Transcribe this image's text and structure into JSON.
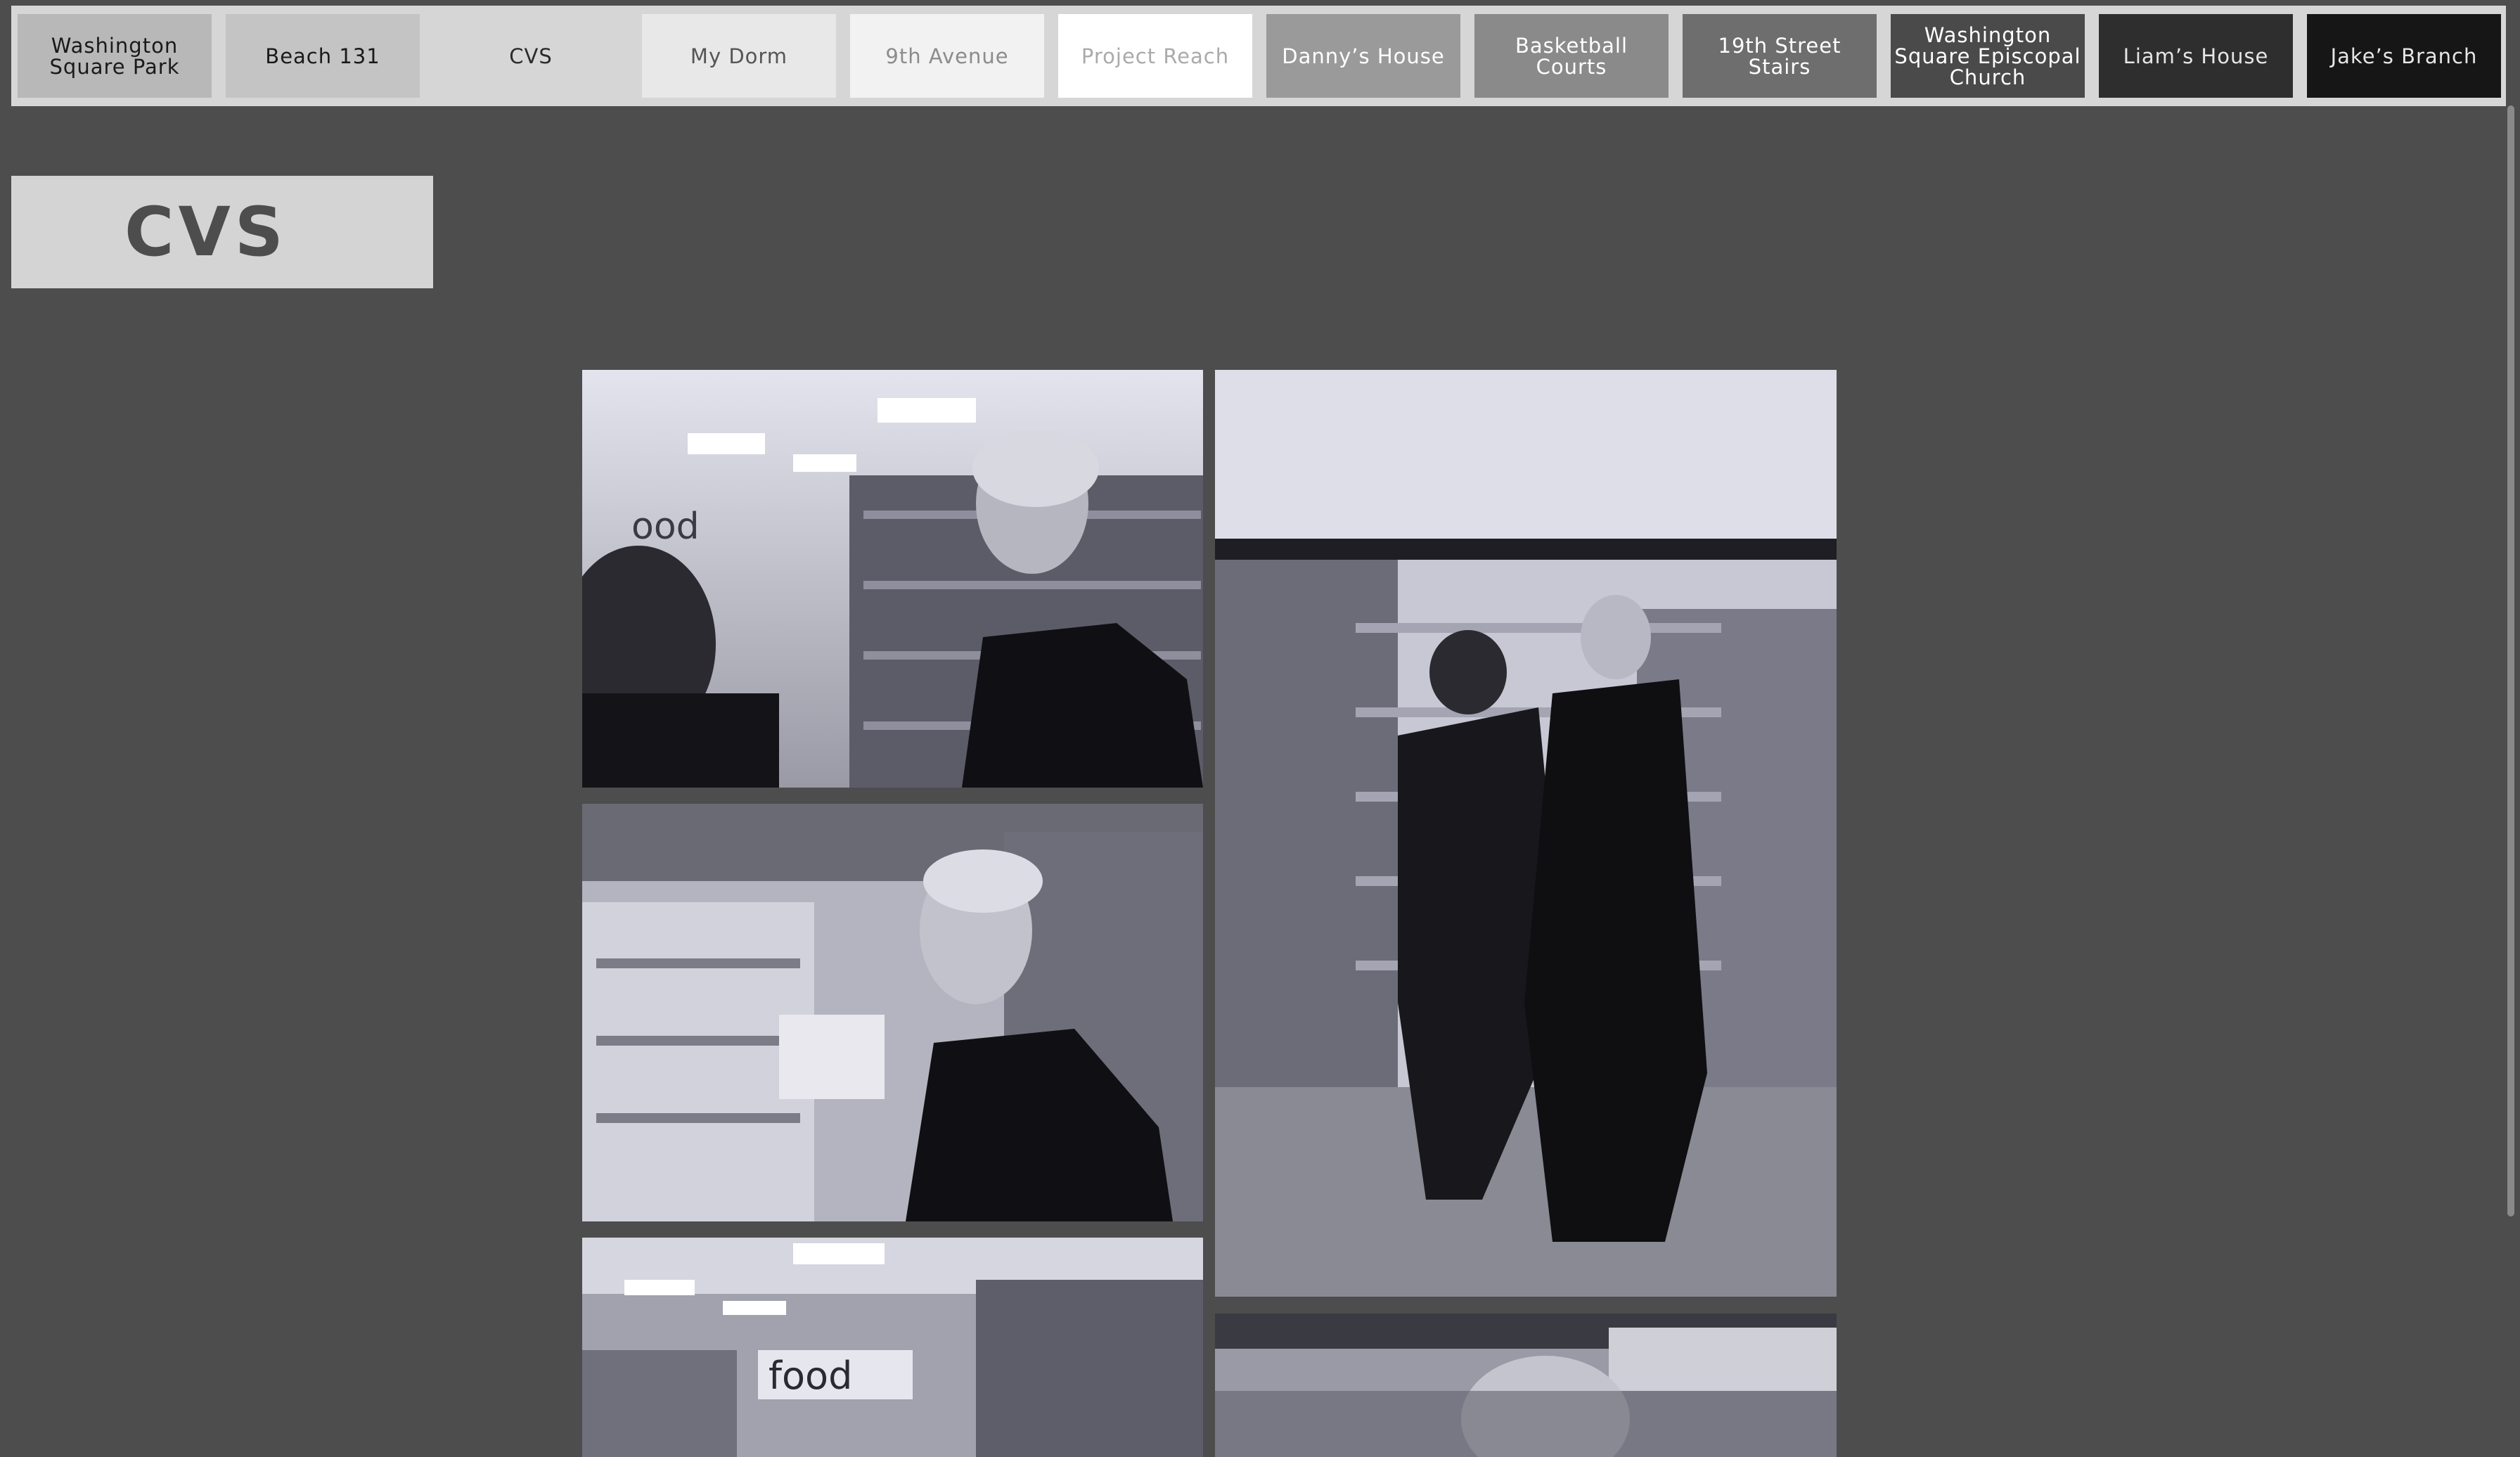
{
  "nav": {
    "tabs": [
      {
        "label": "Washington Square Park",
        "bg": "#b8b8b8",
        "fg": "#1a1a1a"
      },
      {
        "label": "Beach 131",
        "bg": "#c4c4c4",
        "fg": "#1a1a1a"
      },
      {
        "label": "CVS",
        "bg": "#d6d6d6",
        "fg": "#2b2b2b"
      },
      {
        "label": "My Dorm",
        "bg": "#e8e8e8",
        "fg": "#555555"
      },
      {
        "label": "9th Avenue",
        "bg": "#f2f2f2",
        "fg": "#8c8c8c"
      },
      {
        "label": "Project Reach",
        "bg": "#ffffff",
        "fg": "#aaaaaa"
      },
      {
        "label": "Danny’s House",
        "bg": "#9a9a9a",
        "fg": "#ffffff"
      },
      {
        "label": "Basketball Courts",
        "bg": "#8a8a8a",
        "fg": "#ffffff"
      },
      {
        "label": "19th Street Stairs",
        "bg": "#6e6e6e",
        "fg": "#ffffff"
      },
      {
        "label": "Washington Square Episcopal Church",
        "bg": "#4a4a4a",
        "fg": "#ffffff"
      },
      {
        "label": "Liam’s House",
        "bg": "#2e2e2e",
        "fg": "#e6e6e6"
      },
      {
        "label": "Jake’s Branch",
        "bg": "#161616",
        "fg": "#e6e6e6"
      }
    ]
  },
  "page": {
    "title": "CVS"
  },
  "gallery": {
    "photos": [
      {
        "sign_text": "ood"
      },
      {
        "sign_text": ""
      },
      {
        "sign_text": ""
      },
      {
        "sign_text": "food"
      },
      {
        "sign_text": ""
      }
    ]
  },
  "colors": {
    "background": "#4d4d4d",
    "nav_bar": "#d6d6d6",
    "title_box": "#d4d4d4"
  }
}
